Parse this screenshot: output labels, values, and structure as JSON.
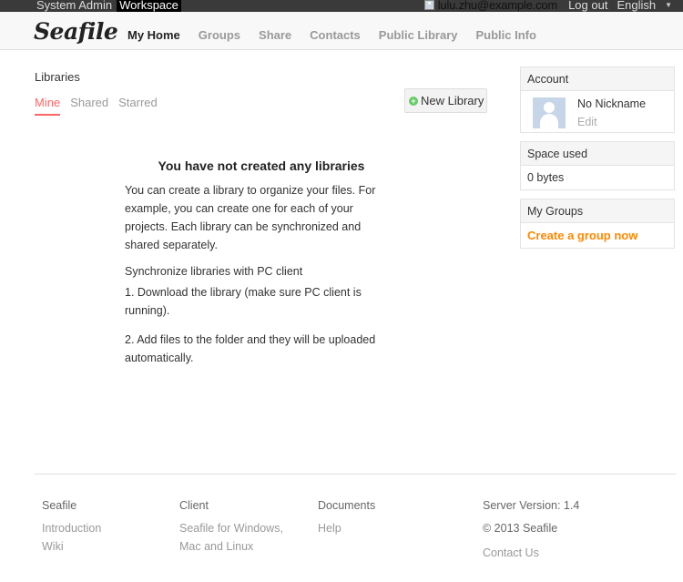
{
  "topbar": {
    "system_admin": "System Admin",
    "workspace": "Workspace",
    "user_email": "lulu.zhu@example.com",
    "logout": "Log out",
    "language": "English"
  },
  "header": {
    "logo": "Seafile",
    "nav": [
      "My Home",
      "Groups",
      "Share",
      "Contacts",
      "Public Library",
      "Public Info"
    ]
  },
  "main": {
    "title": "Libraries",
    "tabs": [
      "Mine",
      "Shared",
      "Starred"
    ],
    "new_library": "New Library",
    "empty": {
      "heading": "You have not created any libraries",
      "intro": "You can create a library to organize your files. For example, you can create one for each of your projects. Each library can be synchronized and shared separately.",
      "sync_heading": "Synchronize libraries with PC client",
      "step1": "1. Download the library (make sure PC client is running).",
      "step2": "2. Add files to the folder and they will be uploaded automatically."
    }
  },
  "side": {
    "account": {
      "title": "Account",
      "nickname": "No Nickname",
      "edit": "Edit"
    },
    "space": {
      "title": "Space used",
      "value": "0 bytes"
    },
    "groups": {
      "title": "My Groups",
      "create": "Create a group now"
    }
  },
  "footer": {
    "seafile": {
      "title": "Seafile",
      "links": [
        "Introduction",
        "Wiki"
      ]
    },
    "client": {
      "title": "Client",
      "link": "Seafile for Windows, Mac and Linux"
    },
    "documents": {
      "title": "Documents",
      "link": "Help"
    },
    "info": {
      "version": "Server Version: 1.4",
      "copyright": "© 2013 Seafile",
      "contact": "Contact Us"
    }
  },
  "colors": {
    "accent": "#f66",
    "orange": "#f80",
    "topbar": "#3a3a3a"
  }
}
